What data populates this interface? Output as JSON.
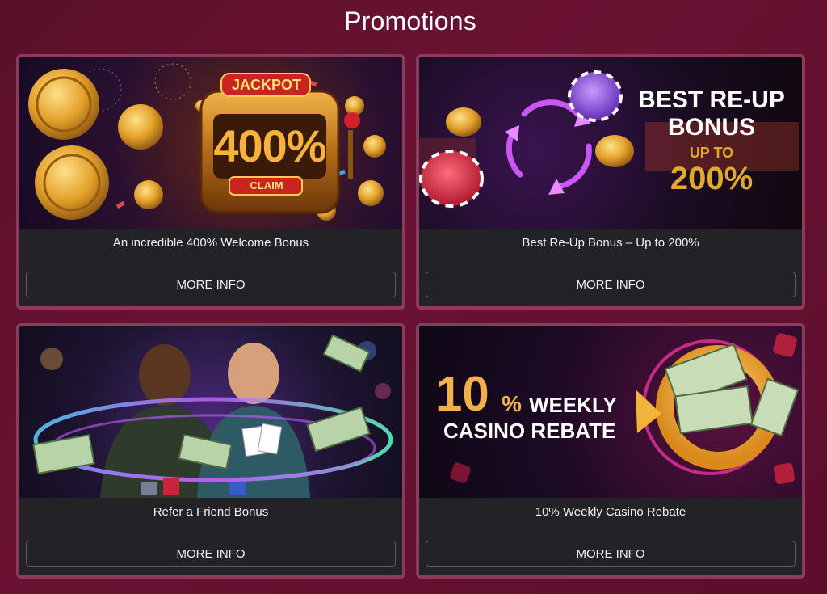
{
  "page": {
    "title": "Promotions"
  },
  "promotions": [
    {
      "title": "An incredible 400% Welcome Bonus",
      "button_label": "MORE INFO",
      "banner_text": {
        "top": "JACKPOT",
        "main": "400%",
        "bottom": "CLAIM"
      }
    },
    {
      "title": "Best Re-Up Bonus – Up to 200%",
      "button_label": "MORE INFO",
      "banner_text": {
        "line1": "BEST RE-UP",
        "line2": "BONUS",
        "line3": "UP TO",
        "line4": "200%"
      }
    },
    {
      "title": "Refer a Friend Bonus",
      "button_label": "MORE INFO"
    },
    {
      "title": "10% Weekly Casino Rebate",
      "button_label": "MORE INFO",
      "banner_text": {
        "num": "10",
        "pct": "%",
        "line1": "WEEKLY",
        "line2": "CASINO REBATE"
      }
    }
  ],
  "colors": {
    "background": "#6b1233",
    "card_border": "#8d3b5c",
    "card_body": "#232226",
    "gold": "#f2b43a",
    "neon_purple": "#c35cff"
  }
}
